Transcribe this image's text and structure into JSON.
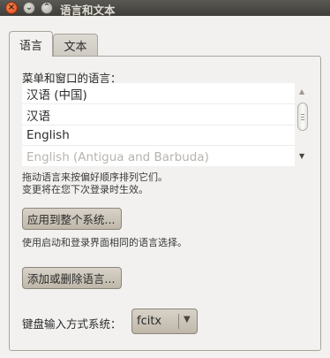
{
  "window": {
    "title": "语言和文本"
  },
  "tabs": [
    {
      "label": "语言",
      "active": true
    },
    {
      "label": "文本",
      "active": false
    }
  ],
  "language": {
    "list_label": "菜单和窗口的语言：",
    "items": [
      {
        "label": "汉语 (中国)"
      },
      {
        "label": "汉语"
      },
      {
        "label": "English"
      },
      {
        "label": "English (Antigua and Barbuda)"
      }
    ],
    "hint_line1": "拖动语言来按偏好顺序排列它们。",
    "hint_line2": "变更将在您下次登录时生效。",
    "apply_button": "应用到整个系统...",
    "apply_hint": "使用启动和登录界面相同的语言选择。",
    "install_button": "添加或删除语言...",
    "keyboard_label": "键盘输入方式系统：",
    "keyboard_value": "fcitx"
  },
  "colors": {
    "titlebar": "#3e3d39",
    "close_button": "#df4a16",
    "button_face": "#c9c2b5"
  },
  "icons": [
    "close-icon",
    "minimize-icon",
    "maximize-icon",
    "scroll-up-icon",
    "scroll-down-icon",
    "dropdown-arrow-icon"
  ]
}
